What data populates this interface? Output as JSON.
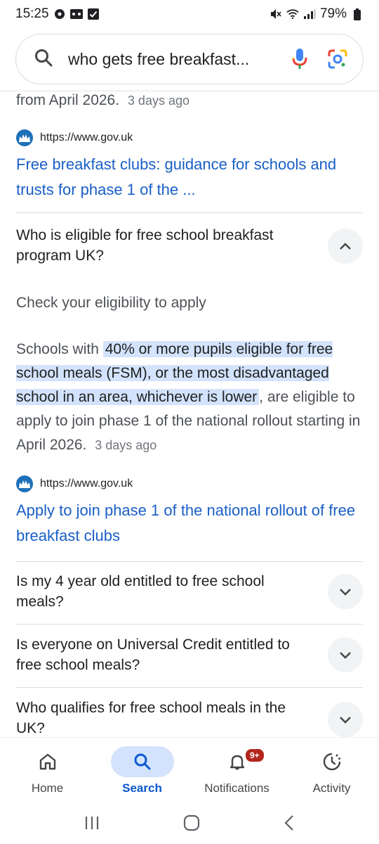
{
  "status": {
    "time": "15:25",
    "battery": "79%"
  },
  "search": {
    "query": "who gets free breakfast..."
  },
  "results": {
    "tail_text": "from April 2026.",
    "tail_date": "3 days ago",
    "result1": {
      "source_url": "https://www.gov.uk",
      "title": "Free breakfast clubs: guidance for schools and trusts for phase 1 of the ..."
    },
    "result2": {
      "source_url": "https://www.gov.uk",
      "title": "Apply to join phase 1 of the national rollout of free breakfast clubs"
    }
  },
  "faq": {
    "q1": "Who is eligible for free school breakfast program UK?",
    "answer_heading": "Check your eligibility to apply",
    "answer_prefix": "Schools with",
    "answer_highlight": "40% or more pupils eligible for free school meals (FSM), or the most disadvantaged school in an area, whichever is lower",
    "answer_suffix": ", are eligible to apply to join phase 1 of the national rollout starting in April 2026.",
    "answer_date": "3 days ago",
    "q2": "Is my 4 year old entitled to free school meals?",
    "q3": "Is everyone on Universal Credit entitled to free school meals?",
    "q4": "Who qualifies for free school meals in the UK?"
  },
  "nav": {
    "home": "Home",
    "search": "Search",
    "notifications": "Notifications",
    "notifications_badge": "9+",
    "activity": "Activity"
  },
  "colors": {
    "link": "#1a5fc7",
    "highlight": "#d3e3fd",
    "active_nav": "#0b57d0"
  }
}
